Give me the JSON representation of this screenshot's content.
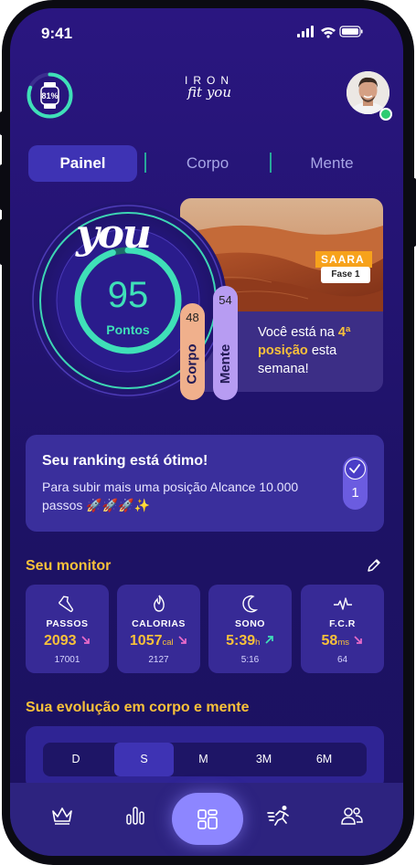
{
  "status_bar": {
    "time": "9:41"
  },
  "header": {
    "ring_progress_label": "81",
    "ring_progress_value": 0.81,
    "logo_top": "IRON",
    "logo_bottom": "fit you"
  },
  "tabs": [
    {
      "label": "Painel",
      "active": true
    },
    {
      "label": "Corpo",
      "active": false
    },
    {
      "label": "Mente",
      "active": false
    }
  ],
  "hero": {
    "you_text": "you",
    "score": "95",
    "score_label": "Pontos",
    "corpo": {
      "value": "48",
      "label": "Corpo"
    },
    "mente": {
      "value": "54",
      "label": "Mente"
    },
    "location_tag": "SAARA",
    "phase_badge": "Fase 1",
    "position_prefix": "Você está na ",
    "position_rank": "4ª",
    "position_word": "posição",
    "position_suffix": " esta semana!"
  },
  "ranking_card": {
    "title": "Seu ranking está ótimo!",
    "body": "Para subir mais uma posição Alcance 10.000 passos 🚀🚀🚀✨",
    "toggle_value": "1"
  },
  "monitor": {
    "title": "Seu monitor",
    "items": [
      {
        "name": "PASSOS",
        "icon": "shoe-icon",
        "value": "2093",
        "unit": "",
        "trend": "down",
        "target": "17001"
      },
      {
        "name": "CALORIAS",
        "icon": "flame-icon",
        "value": "1057",
        "unit": "cal",
        "trend": "down",
        "target": "2127"
      },
      {
        "name": "SONO",
        "icon": "moon-icon",
        "value": "5:39",
        "unit": "h",
        "trend": "up",
        "target": "5:16"
      },
      {
        "name": "F.C.R",
        "icon": "heartbeat-icon",
        "value": "58",
        "unit": "ms",
        "trend": "down",
        "target": "64"
      }
    ]
  },
  "evolution": {
    "title": "Sua evolução em corpo e mente",
    "ranges": [
      {
        "label": "D",
        "active": false
      },
      {
        "label": "S",
        "active": true
      },
      {
        "label": "M",
        "active": false
      },
      {
        "label": "3M",
        "active": false
      },
      {
        "label": "6M",
        "active": false
      }
    ]
  },
  "bottom_nav": [
    {
      "icon": "crown-icon"
    },
    {
      "icon": "bar-chart-icon"
    },
    {
      "icon": "dashboard-grid-icon",
      "active": true
    },
    {
      "icon": "running-icon"
    },
    {
      "icon": "users-icon"
    }
  ],
  "colors": {
    "background": "#241473",
    "accent": "#3e33b4",
    "highlight": "#f8c13a",
    "score_green": "#3fe0b8",
    "corpo_pill": "#f0b08c",
    "mente_pill": "#b79cf2"
  }
}
